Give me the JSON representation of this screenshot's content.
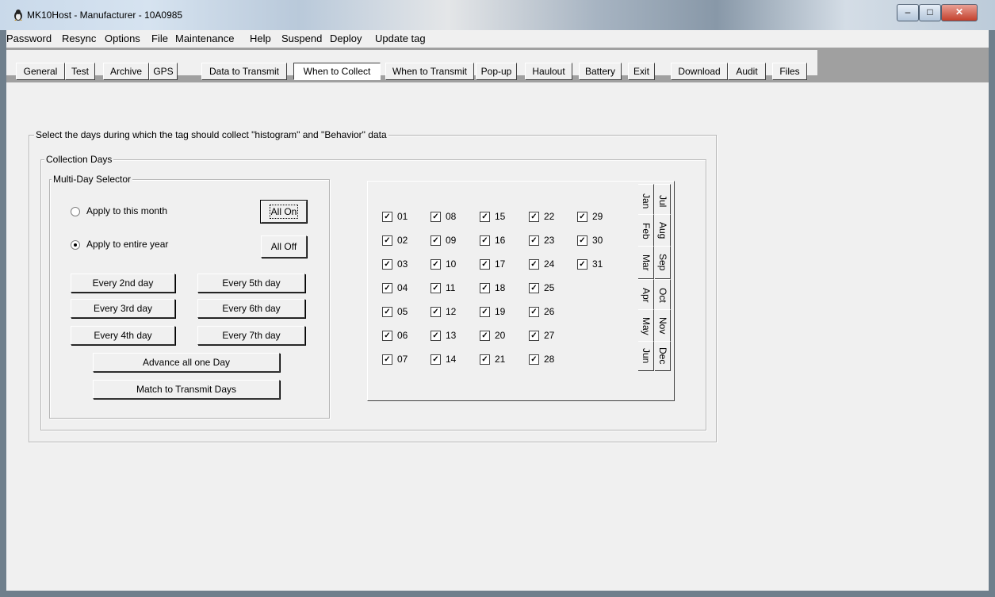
{
  "window": {
    "title": "MK10Host - Manufacturer - 10A0985",
    "app_icon": "penguin-icon",
    "controls": {
      "minimize": "–",
      "maximize": "□",
      "close": "✕"
    }
  },
  "menubar": {
    "items": [
      "Password",
      "Resync",
      "Options",
      "File",
      "Maintenance",
      "Help",
      "Suspend",
      "Deploy",
      "Update tag"
    ]
  },
  "tabs": {
    "items": [
      "General",
      "Test",
      "Archive",
      "GPS",
      "Data to Transmit",
      "When to Collect",
      "When to Transmit",
      "Pop-up",
      "Haulout",
      "Battery",
      "Exit",
      "Download",
      "Audit",
      "Files"
    ],
    "active": "When to Collect"
  },
  "collect": {
    "outer_label": "Select the days during which the tag should collect \"histogram\" and \"Behavior\" data",
    "days_label": "Collection Days",
    "multi_label": "Multi-Day Selector",
    "radio_month": "Apply to this month",
    "radio_year": "Apply to entire year",
    "radio_selected": "Apply to entire year",
    "all_on": "All On",
    "all_off": "All Off",
    "every2": "Every 2nd day",
    "every3": "Every 3rd day",
    "every4": "Every 4th day",
    "every5": "Every 5th day",
    "every6": "Every 6th day",
    "every7": "Every 7th day",
    "advance": "Advance all one Day",
    "match": "Match to Transmit Days"
  },
  "days": {
    "labels": [
      "01",
      "02",
      "03",
      "04",
      "05",
      "06",
      "07",
      "08",
      "09",
      "10",
      "11",
      "12",
      "13",
      "14",
      "15",
      "16",
      "17",
      "18",
      "19",
      "20",
      "21",
      "22",
      "23",
      "24",
      "25",
      "26",
      "27",
      "28",
      "29",
      "30",
      "31"
    ],
    "checked": true,
    "check_mark": "✓"
  },
  "months": {
    "left": [
      "Jan",
      "Feb",
      "Mar",
      "Apr",
      "May",
      "Jun"
    ],
    "right": [
      "Jul",
      "Aug",
      "Sep",
      "Oct",
      "Nov",
      "Dec"
    ],
    "active": "Jan"
  }
}
